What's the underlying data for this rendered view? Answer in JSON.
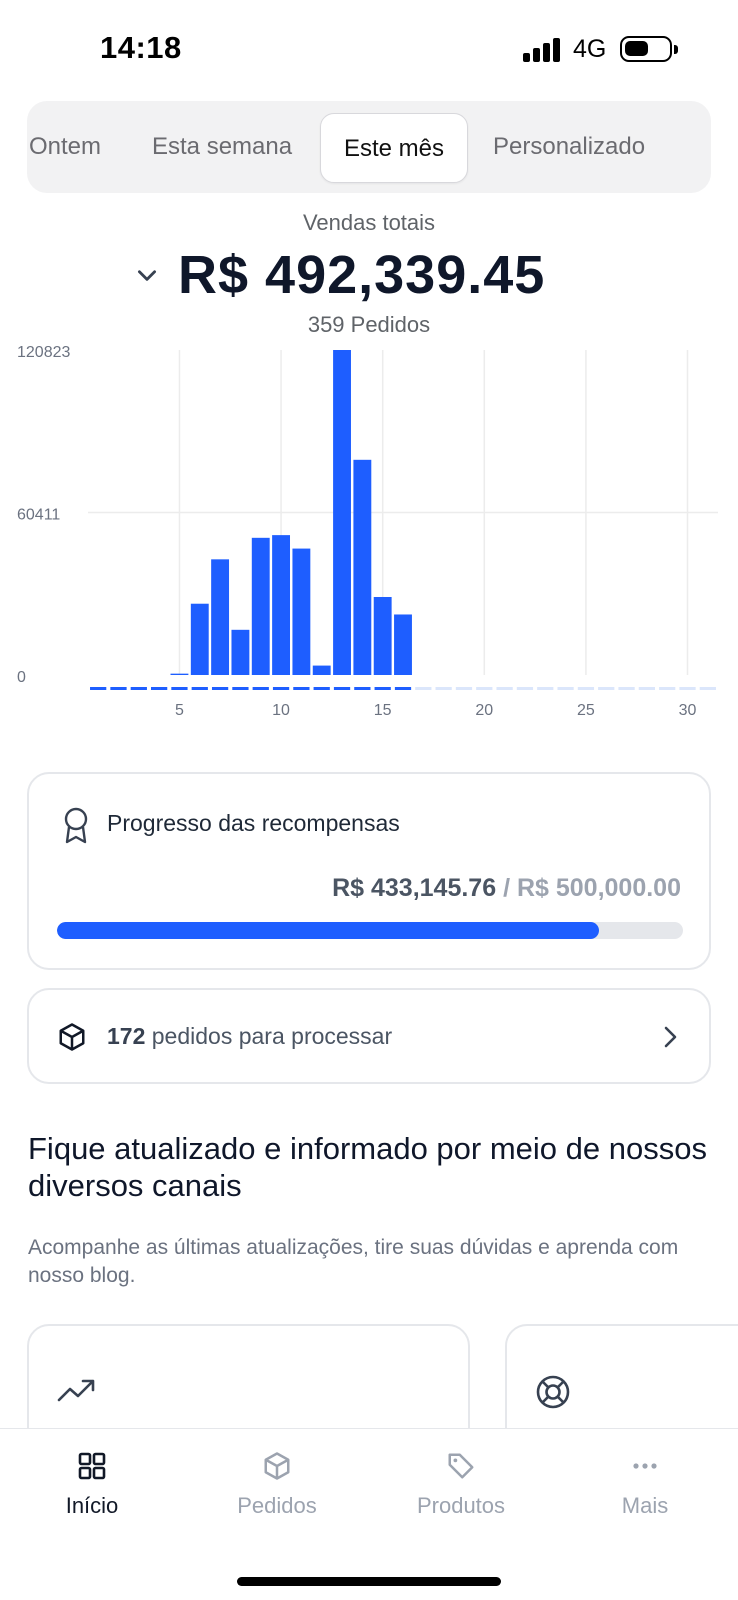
{
  "status_bar": {
    "time": "14:18",
    "network": "4G"
  },
  "tabs": [
    {
      "label": "Ontem",
      "active": false
    },
    {
      "label": "Esta semana",
      "active": false
    },
    {
      "label": "Este mês",
      "active": true
    },
    {
      "label": "Personalizado",
      "active": false
    }
  ],
  "summary": {
    "label": "Vendas totais",
    "amount": "R$ 492,339.45",
    "orders": "359 Pedidos"
  },
  "chart_data": {
    "type": "bar",
    "y_tick_labels": [
      "120823",
      "60411",
      "0"
    ],
    "x_tick_labels": [
      "5",
      "10",
      "15",
      "20",
      "25",
      "30"
    ],
    "ylim": [
      0,
      120823
    ],
    "xlim": [
      1,
      31
    ],
    "grid": true,
    "bar_color": "#1e5eff",
    "x": [
      5,
      6,
      7,
      8,
      9,
      10,
      11,
      12,
      13,
      14,
      15,
      16
    ],
    "values": [
      500,
      26500,
      43000,
      16800,
      51000,
      52000,
      47000,
      3500,
      120823,
      80000,
      29000,
      22500
    ],
    "days_elapsed": 16,
    "days_total": 31
  },
  "rewards": {
    "title": "Progresso das recompensas",
    "current": "R$ 433,145.76",
    "separator": " / ",
    "goal": "R$ 500,000.00",
    "progress_fraction": 0.866
  },
  "orders_to_process": {
    "count": "172",
    "text": " pedidos para processar"
  },
  "info": {
    "title": "Fique atualizado e informado por meio de nossos diversos canais",
    "description": "Acompanhe as últimas atualizações, tire suas dúvidas e aprenda com nosso blog."
  },
  "cards": [
    {
      "icon": "trending-up-icon"
    },
    {
      "icon": "lifebuoy-icon"
    }
  ],
  "nav": [
    {
      "label": "Início",
      "icon": "grid-icon",
      "active": true
    },
    {
      "label": "Pedidos",
      "icon": "box-icon",
      "active": false
    },
    {
      "label": "Produtos",
      "icon": "tag-icon",
      "active": false
    },
    {
      "label": "Mais",
      "icon": "more-icon",
      "active": false
    }
  ]
}
